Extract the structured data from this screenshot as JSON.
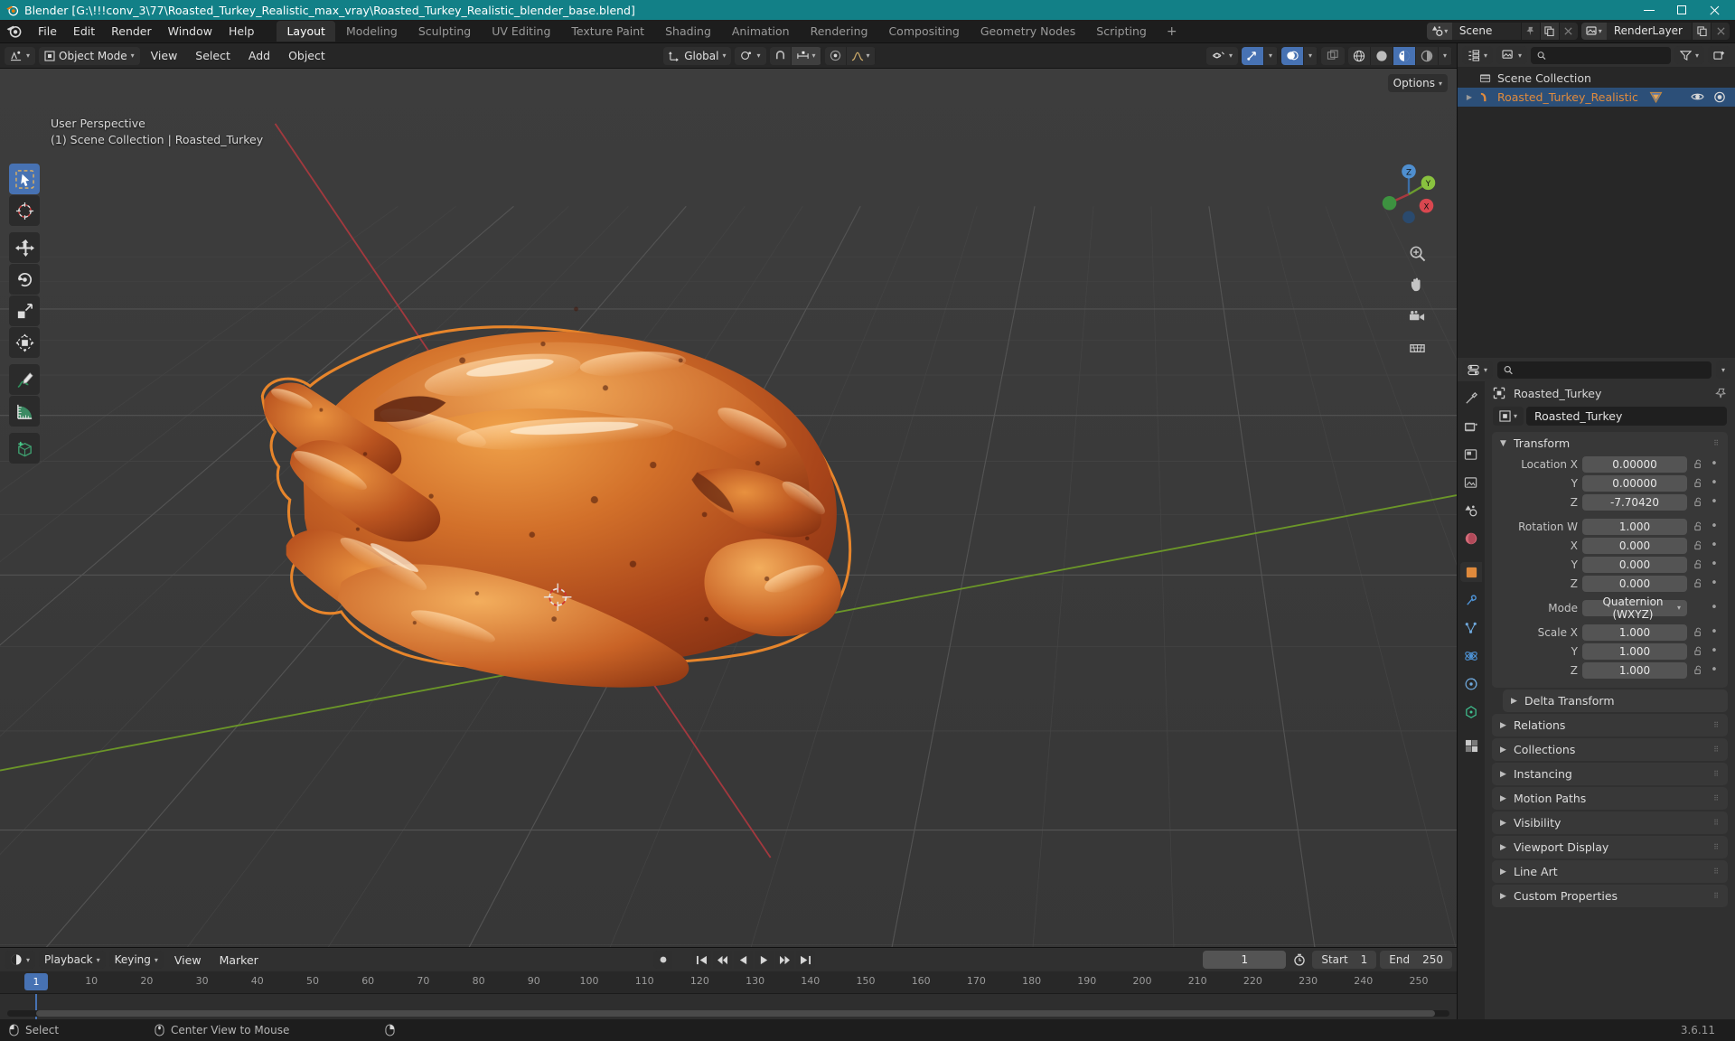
{
  "window": {
    "title": "Blender [G:\\!!!conv_3\\77\\Roasted_Turkey_Realistic_max_vray\\Roasted_Turkey_Realistic_blender_base.blend]",
    "minimize": "minimize",
    "maximize": "maximize",
    "close": "close"
  },
  "topbar": {
    "menus": [
      "File",
      "Edit",
      "Render",
      "Window",
      "Help"
    ],
    "workspaces": [
      {
        "label": "Layout",
        "active": true
      },
      {
        "label": "Modeling",
        "active": false
      },
      {
        "label": "Sculpting",
        "active": false
      },
      {
        "label": "UV Editing",
        "active": false
      },
      {
        "label": "Texture Paint",
        "active": false
      },
      {
        "label": "Shading",
        "active": false
      },
      {
        "label": "Animation",
        "active": false
      },
      {
        "label": "Rendering",
        "active": false
      },
      {
        "label": "Compositing",
        "active": false
      },
      {
        "label": "Geometry Nodes",
        "active": false
      },
      {
        "label": "Scripting",
        "active": false
      }
    ],
    "add_workspace": "+",
    "scene_name": "Scene",
    "view_layer_name": "RenderLayer"
  },
  "viewport_header": {
    "mode": "Object Mode",
    "menus": [
      "View",
      "Select",
      "Add",
      "Object"
    ],
    "transform_orientation": "Global",
    "options_label": "Options"
  },
  "viewport": {
    "perspective": "User Perspective",
    "collection_line": "(1) Scene Collection | Roasted_Turkey",
    "gizmo_axes": [
      "X",
      "Y",
      "Z"
    ],
    "tools": [
      "tweak-select-box-tool",
      "cursor-tool",
      "move-tool",
      "rotate-tool",
      "scale-tool",
      "transform-tool",
      "annotate-tool",
      "measure-tool",
      "add-cube-tool"
    ]
  },
  "outliner": {
    "search_placeholder": "",
    "scene_collection": "Scene Collection",
    "object_name": "Roasted_Turkey_Realistic"
  },
  "properties": {
    "search_placeholder": "",
    "breadcrumb_object": "Roasted_Turkey",
    "id_name": "Roasted_Turkey",
    "transform": {
      "title": "Transform",
      "rows": [
        {
          "label": "Location X",
          "value": "0.00000"
        },
        {
          "label": "Y",
          "value": "0.00000"
        },
        {
          "label": "Z",
          "value": "-7.70420"
        },
        {
          "label": "Rotation W",
          "value": "1.000"
        },
        {
          "label": "X",
          "value": "0.000"
        },
        {
          "label": "Y",
          "value": "0.000"
        },
        {
          "label": "Z",
          "value": "0.000"
        }
      ],
      "mode_label": "Mode",
      "mode_value": "Quaternion (WXYZ)",
      "scale_rows": [
        {
          "label": "Scale X",
          "value": "1.000"
        },
        {
          "label": "Y",
          "value": "1.000"
        },
        {
          "label": "Z",
          "value": "1.000"
        }
      ]
    },
    "sub_panel": "Delta Transform",
    "panels": [
      "Relations",
      "Collections",
      "Instancing",
      "Motion Paths",
      "Visibility",
      "Viewport Display",
      "Line Art",
      "Custom Properties"
    ]
  },
  "timeline": {
    "menus": [
      "Playback",
      "Keying",
      "View",
      "Marker"
    ],
    "current_frame": "1",
    "start_label": "Start",
    "start_value": "1",
    "end_label": "End",
    "end_value": "250",
    "ticks": [
      "1",
      "10",
      "20",
      "30",
      "40",
      "50",
      "60",
      "70",
      "80",
      "90",
      "100",
      "110",
      "120",
      "130",
      "140",
      "150",
      "160",
      "170",
      "180",
      "190",
      "200",
      "210",
      "220",
      "230",
      "240",
      "250"
    ]
  },
  "statusbar": {
    "mouse_left_action": "Select",
    "mouse_middle_action": "Center View to Mouse",
    "version": "3.6.11"
  },
  "colors": {
    "title_bar": "#128087",
    "accent_blue": "#4772b3",
    "object_orange": "#e08a3c",
    "axis_x_red": "#bf4c4c",
    "axis_y_green": "#7cbc32",
    "viewport_bg": "#393939"
  }
}
